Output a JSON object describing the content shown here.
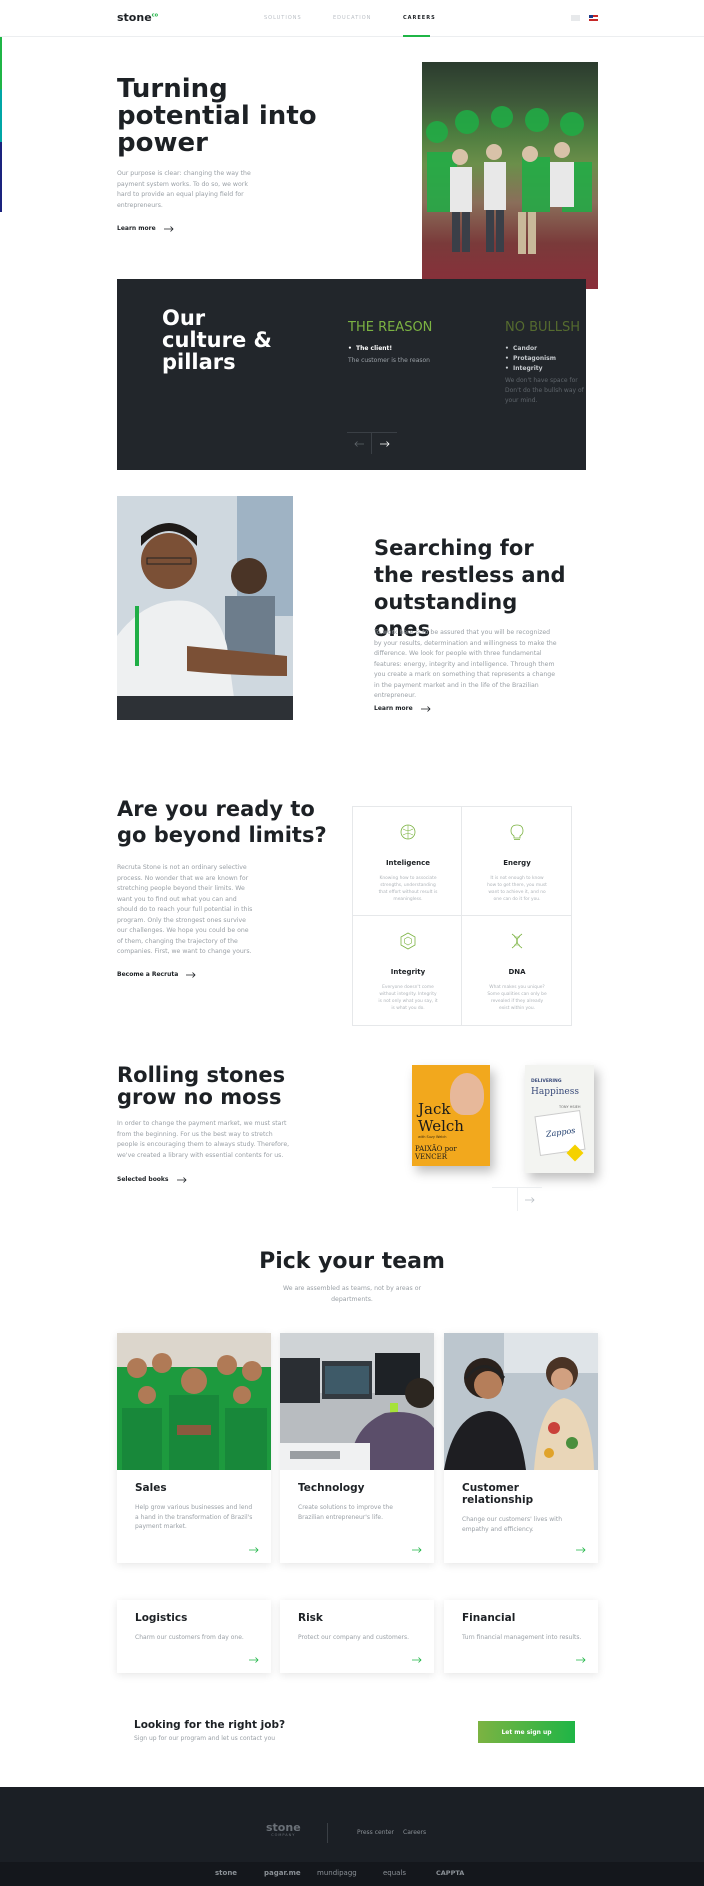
{
  "header": {
    "logo": "stone",
    "logo_sup": "co",
    "nav": [
      "SOLUTIONS",
      "EDUCATION",
      "CAREERS"
    ],
    "active_nav": "CAREERS"
  },
  "hero": {
    "title": "Turning potential into power",
    "body": "Our purpose is clear: changing the way the payment system works. To do so, we work hard to provide an equal playing field for entrepreneurs.",
    "link": "Learn more"
  },
  "culture": {
    "title": "Our culture & pillars",
    "col1": {
      "heading": "THE REASON",
      "bullet": "The client!",
      "text": "The customer is the reason"
    },
    "col2": {
      "heading": "NO BULLSH",
      "bullets": [
        "Candor",
        "Protagonism",
        "Integrity"
      ],
      "text": "We don't have space for Don't do the bullsh way of your mind."
    }
  },
  "search": {
    "title": "Searching for the restless and outstanding ones",
    "body": "To work here is to be assured that you will be recognized by your results, determination and willingness to make the difference. We look for people with three fundamental features: energy, integrity and intelligence. Through them you create a mark on something that represents a change in the payment market and in the life of the Brazilian entrepreneur.",
    "link": "Learn more"
  },
  "ready": {
    "title": "Are you ready to go beyond limits?",
    "body": "Recruta Stone is not an ordinary selective process. No wonder that we are known for stretching people beyond their limits. We want you to find out what you can and should do to reach your full potential in this program. Only the strongest ones survive our challenges. We hope you could be one of them, changing the trajectory of the companies. First, we want to change yours.",
    "link": "Become a Recruta",
    "traits": [
      {
        "icon": "brain-icon",
        "name": "Inteligence",
        "text": "Knowing how to associate strengths, understanding that effort without result is meaningless."
      },
      {
        "icon": "bulb-icon",
        "name": "Energy",
        "text": "It is not enough to know how to get there, you must want to achieve it, and no one can do it for you."
      },
      {
        "icon": "hexagon-icon",
        "name": "Integrity",
        "text": "Everyone doesn't come without integrity. Integrity is not only what you say, it is what you do."
      },
      {
        "icon": "dna-icon",
        "name": "DNA",
        "text": "What makes you unique? Some qualities can only be revealed if they already exist within you."
      }
    ]
  },
  "rolling": {
    "title": "Rolling stones grow no moss",
    "body": "In order to change the payment market, we must start from the beginning. For us the best way to stretch people is encouraging them to always study. Therefore, we've created a library with essential contents for us.",
    "link": "Selected books",
    "books": [
      {
        "title_top": "Jack",
        "title_mid": "Welch",
        "sub": "PAIXÃO por VENCER",
        "author": "with Suzy Welch"
      },
      {
        "title_top": "DELIVERING",
        "title_mid": "Happiness",
        "sub": "Zappos",
        "author": "TONY HSIEH"
      }
    ]
  },
  "teams": {
    "title": "Pick your team",
    "subtitle": "We are assembled as teams, not by areas or departments.",
    "cards": [
      {
        "name": "Sales",
        "text": "Help grow various businesses and lend a hand in the transformation of Brazil's payment market."
      },
      {
        "name": "Technology",
        "text": "Create solutions to improve the Brazilian entrepreneur's life."
      },
      {
        "name": "Customer relationship",
        "text": "Change our customers' lives with empathy and efficiency."
      }
    ],
    "small_cards": [
      {
        "name": "Logistics",
        "text": "Charm our customers from day one."
      },
      {
        "name": "Risk",
        "text": "Protect our company and customers."
      },
      {
        "name": "Financial",
        "text": "Turn financial management into results."
      }
    ]
  },
  "cta": {
    "title": "Looking for the right job?",
    "subtitle": "Sign up for our program and let us contact you",
    "button": "Let me sign up"
  },
  "footer": {
    "logo": "stone",
    "logo_sub": "COMPANY",
    "links": [
      "Press center",
      "Careers"
    ],
    "brands": [
      "stone",
      "pagar.me",
      "mundipagg",
      "equals",
      "CAPPTA"
    ]
  },
  "colors": {
    "green": "#1fb546",
    "lime": "#7cb342",
    "dark": "#22262b",
    "footer": "#1b1f25"
  }
}
